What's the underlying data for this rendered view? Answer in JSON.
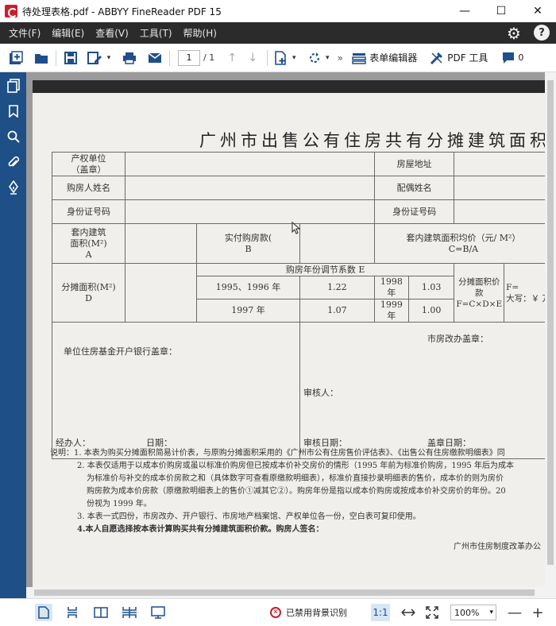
{
  "window": {
    "title": "待处理表格.pdf - ABBYY FineReader PDF 15",
    "minimize": "—",
    "maximize": "☐",
    "close": "✕"
  },
  "menu": {
    "items": [
      "文件(F)",
      "编辑(E)",
      "查看(V)",
      "工具(T)",
      "帮助(H)"
    ],
    "help_glyph": "?",
    "gear_glyph": "⚙"
  },
  "toolbar": {
    "page_current": "1",
    "page_total": "/ 1",
    "form_editor_label": "表单编辑器",
    "pdf_tools_label": "PDF 工具",
    "comments_count": "0",
    "overflow": "»"
  },
  "document": {
    "title": "广州市出售公有住房共有分摊建筑面积计价表",
    "fields": {
      "owner_unit_1": "产权单位",
      "owner_unit_2": "（盖章）",
      "house_address": "房屋地址",
      "buyer_name": "购房人姓名",
      "spouse_name": "配偶姓名",
      "id_number": "身份证号码",
      "id_number_2": "身份证号码",
      "inner_area_1": "套内建筑",
      "inner_area_2": "面积(M²)",
      "inner_area_3": "A",
      "paid_1": "实付购房款(",
      "paid_2": "B",
      "avg_price_1": "套内建筑面积均价（元/ M²）",
      "avg_price_2": "C=B/A",
      "shared_area_1": "分摊面积(M²)",
      "shared_area_2": "D",
      "year_coef": "购房年份调节系数 E",
      "y1": "1995、1996 年",
      "v1": "1.22",
      "y2": "1998 年",
      "v2": "1.03",
      "y3": "1997 年",
      "v3": "1.07",
      "y4": "1999 年",
      "v4": "1.00",
      "shared_price_1": "分摊面积价款",
      "shared_price_2": "F=C×D×E",
      "f_eq": "F=",
      "capital": "大写：￥      万",
      "bank_stamp": "单位住房基金开户银行盖章：",
      "handler": "经办人：",
      "date1": "日期：",
      "reform_office": "市房改办盖章：",
      "reviewer": "审核人：",
      "review_date": "审核日期：",
      "stamp_date": "盖章日期："
    },
    "notes": [
      "说明：1. 本表为购买分摊面积简易计价表，与原购分摊面积采用的《广州市公有住房售价评估表》、《出售公有住房缴款明细表》同",
      "2. 本表仅适用于以成本价购房或虽以标准价购房但已按成本价补交房价的情形（1995 年前为标准价购房，1995 年后为成本",
      "为标准价与补交的成本价房款之和（具体数字可查看原缴款明细表），标准价直接抄录明细表的售价，成本价的则为房价",
      "购房款为成本价房款（原缴款明细表上的售价①减其它②）。购房年份是指以成本价购房或按成本价补交房价的年份。20",
      "份视为 1999 年。",
      "3. 本表一式四份，市房改办、开户银行、市房地产档案馆、产权单位各一份，空白表可复印使用。",
      "4.本人自愿选择按本表计算购买共有分摊建筑面积价款。购房人签名："
    ],
    "bureau": "广州市住房制度改革办公"
  },
  "statusbar": {
    "status_text": "已禁用背景识别",
    "ratio_label": "1:1",
    "zoom": "100%",
    "zoom_out": "—",
    "zoom_in": "+"
  },
  "icons": {
    "colors": {
      "accent": "#1f4e8c",
      "sidebar": "#1e4f86",
      "menubar": "#2b2b2b",
      "error": "#c21f2c"
    }
  }
}
